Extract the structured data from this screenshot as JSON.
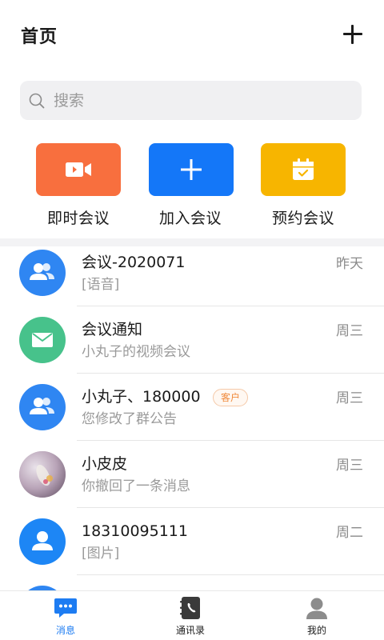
{
  "header": {
    "title": "首页"
  },
  "search": {
    "placeholder": "搜索"
  },
  "quick_actions": [
    {
      "label": "即时会议",
      "icon": "video-camera-icon",
      "color": "#f86f3e"
    },
    {
      "label": "加入会议",
      "icon": "plus-icon",
      "color": "#1477f8"
    },
    {
      "label": "预约会议",
      "icon": "calendar-check-icon",
      "color": "#f7b500"
    }
  ],
  "conversations": [
    {
      "name": "会议-2020071",
      "preview": "[语音]",
      "time": "昨天",
      "avatar": "group-icon",
      "avatar_color": "#2f86f2"
    },
    {
      "name": "会议通知",
      "preview": "小丸子的视频会议",
      "time": "周三",
      "avatar": "envelope-icon",
      "avatar_color": "#47c28b"
    },
    {
      "name": "小丸子、180000",
      "tag": "客户",
      "preview": "您修改了群公告",
      "time": "周三",
      "avatar": "group-icon",
      "avatar_color": "#2f86f2"
    },
    {
      "name": "小皮皮",
      "preview": "你撤回了一条消息",
      "time": "周三",
      "avatar": "photo-avatar",
      "avatar_color": "#c9b8c4"
    },
    {
      "name": "18310095111",
      "preview": "[图片]",
      "time": "周二",
      "avatar": "person-icon",
      "avatar_color": "#1d86f5"
    }
  ],
  "tabbar": {
    "items": [
      {
        "label": "消息",
        "icon": "chat-bubble-icon",
        "active": true
      },
      {
        "label": "通讯录",
        "icon": "contacts-book-icon",
        "active": false
      },
      {
        "label": "我的",
        "icon": "user-profile-icon",
        "active": false
      }
    ]
  },
  "colors": {
    "accent": "#1d7cf2",
    "tag_orange": "#f08a3c"
  }
}
